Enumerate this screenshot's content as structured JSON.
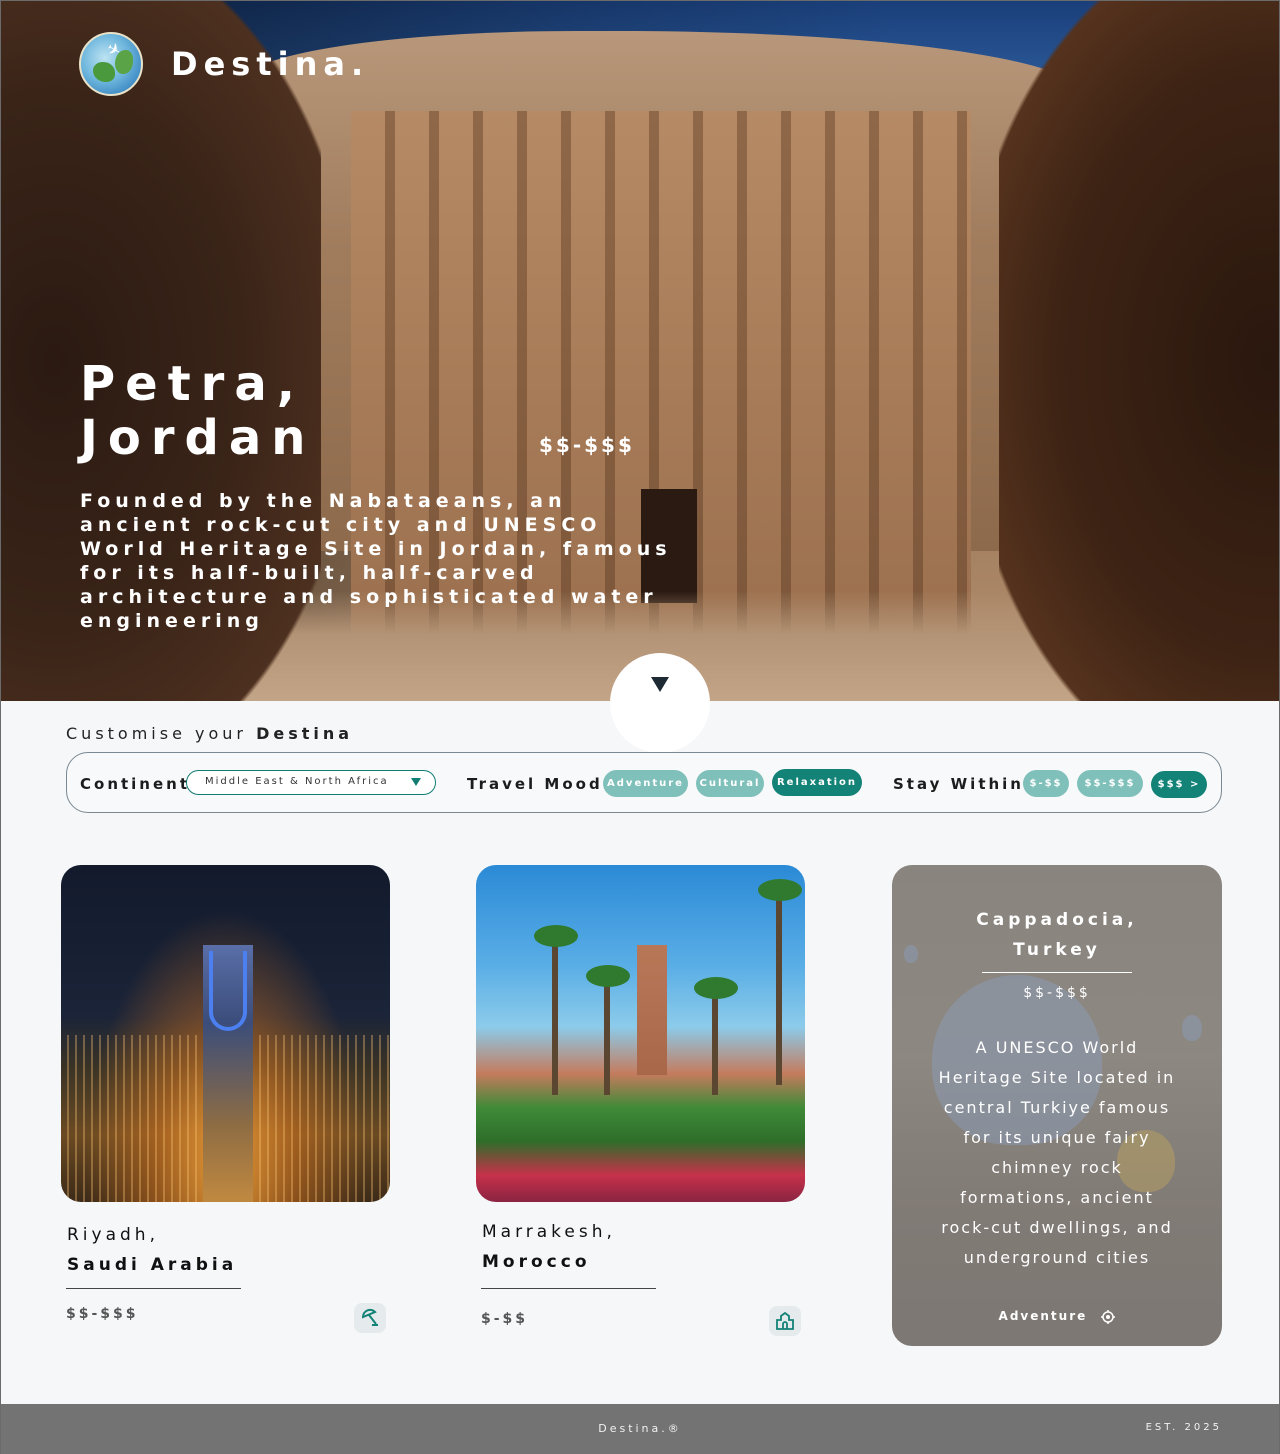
{
  "brand": "Destina.",
  "hero": {
    "title_line1": "Petra,",
    "title_line2": "Jordan",
    "price": "$$-$$$",
    "description": "Founded by the Nabataeans, an ancient rock-cut city and UNESCO World Heritage Site in Jordan, famous for its half-built, half-carved architecture and sophisticated water engineering"
  },
  "customise": {
    "prefix": "Customise your",
    "brand_word": "Destina",
    "continent_label": "Continent",
    "continent_value": "Middle East & North Africa",
    "mood_label": "Travel Mood",
    "moods": [
      "Adventure",
      "Cultural",
      "Relaxation"
    ],
    "stay_label": "Stay Within",
    "budgets": [
      "$-$$",
      "$$-$$$",
      "$$$ >"
    ]
  },
  "cards": [
    {
      "city": "Riyadh,",
      "country": "Saudi Arabia",
      "price": "$$-$$$",
      "icon": "beach-umbrella-icon"
    },
    {
      "city": "Marrakesh,",
      "country": "Morocco",
      "price": "$-$$",
      "icon": "landmark-icon"
    }
  ],
  "featured": {
    "city": "Cappadocia,",
    "country": "Turkey",
    "price": "$$-$$$",
    "description": "A UNESCO World Heritage Site located in central Turkiye famous for its unique fairy chimney rock formations, ancient rock-cut dwellings, and underground cities",
    "tag": "Adventure",
    "tag_icon": "target-icon"
  },
  "footer": {
    "brand": "Destina.®",
    "est": "EST. 2025"
  },
  "colors": {
    "accent": "#138277",
    "accent_light": "#7fc0bb",
    "footer_bg": "#737373"
  }
}
